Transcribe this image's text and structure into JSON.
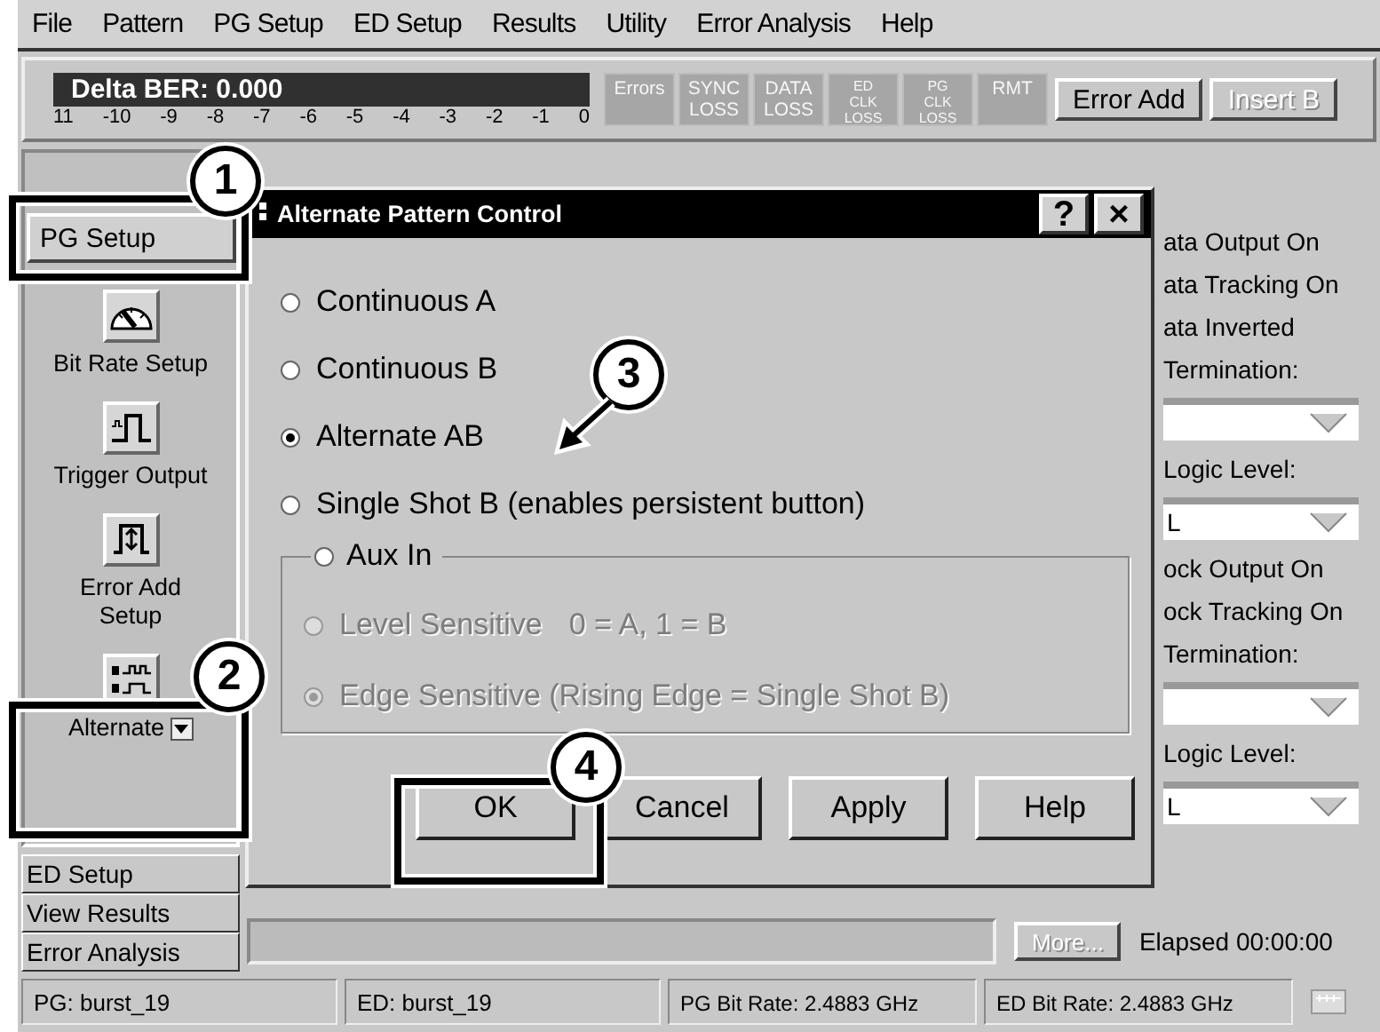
{
  "menu": [
    {
      "label": "File"
    },
    {
      "label": "Pattern"
    },
    {
      "label": "PG Setup"
    },
    {
      "label": "ED Setup"
    },
    {
      "label": "Results"
    },
    {
      "label": "Utility"
    },
    {
      "label": "Error Analysis"
    },
    {
      "label": "Help"
    }
  ],
  "toolbar": {
    "ber_display": {
      "text": "Delta BER: 0.000",
      "scale": [
        "11",
        "-10",
        "-9",
        "-8",
        "-7",
        "-6",
        "-5",
        "-4",
        "-3",
        "-2",
        "-1",
        "0"
      ]
    },
    "lamps": [
      {
        "label": "Errors",
        "kind": "normal"
      },
      {
        "label": "SYNC LOSS",
        "kind": "normal"
      },
      {
        "label": "DATA LOSS",
        "kind": "normal"
      },
      {
        "label": "ED CLK LOSS",
        "kind": "small"
      },
      {
        "label": "PG CLK LOSS",
        "kind": "small"
      },
      {
        "label": "RMT",
        "kind": "normal"
      }
    ],
    "buttons": [
      {
        "label": "Error Add",
        "disabled": false
      },
      {
        "label": "Insert B",
        "disabled": true
      }
    ]
  },
  "sidebar": {
    "top_button": {
      "label": "PG Setup"
    },
    "tools": [
      {
        "label": "Bit Rate Setup",
        "kind": "gauge",
        "dropdown": false
      },
      {
        "label": "Trigger Output",
        "kind": "pulse",
        "dropdown": false
      },
      {
        "label": "Error Add Setup",
        "kind": "error_add",
        "dropdown": false
      },
      {
        "label": "Alternate",
        "kind": "alternate",
        "dropdown": true
      }
    ],
    "bottom_buttons": [
      {
        "label": "ED Setup"
      },
      {
        "label": "View Results"
      },
      {
        "label": "Error Analysis"
      }
    ]
  },
  "right_panel": [
    {
      "kind": "text",
      "label": "ata Output On"
    },
    {
      "kind": "text",
      "label": "ata Tracking On"
    },
    {
      "kind": "text",
      "label": "ata Inverted"
    },
    {
      "kind": "text",
      "label": "Termination:"
    },
    {
      "kind": "dropdown"
    },
    {
      "kind": "text",
      "label": "Logic Level:"
    },
    {
      "kind": "dropdown",
      "value": "L"
    },
    {
      "kind": "text",
      "label": "ock Output On"
    },
    {
      "kind": "text",
      "label": "ock Tracking On"
    },
    {
      "kind": "text",
      "label": "Termination:"
    },
    {
      "kind": "dropdown"
    },
    {
      "kind": "text",
      "label": "Logic Level:"
    },
    {
      "kind": "dropdown",
      "value": "L"
    }
  ],
  "dialog": {
    "title": "Alternate Pattern Control",
    "help_button": "?",
    "close_button": "×",
    "options": [
      {
        "label": "Continuous A",
        "selected": false
      },
      {
        "label": "Continuous B",
        "selected": false
      },
      {
        "label": "Alternate AB",
        "selected": true
      },
      {
        "label": "Single Shot B (enables persistent button)",
        "selected": false
      }
    ],
    "aux_group": {
      "label": "Aux In",
      "selected": false,
      "options": [
        {
          "label": "Level Sensitive",
          "note": "0 = A, 1 = B",
          "selected": false,
          "disabled": true
        },
        {
          "label": "Edge Sensitive (Rising Edge = Single Shot B)",
          "selected": true,
          "disabled": true
        }
      ]
    },
    "buttons": [
      {
        "label": "OK"
      },
      {
        "label": "Cancel"
      },
      {
        "label": "Apply"
      },
      {
        "label": "Help"
      }
    ]
  },
  "bottom_bar": {
    "more_button": {
      "label": "More...",
      "disabled": true
    },
    "elapsed": "Elapsed 00:00:00"
  },
  "status_bar": [
    "PG: burst_19",
    "ED: burst_19",
    "PG Bit Rate: 2.4883 GHz",
    "ED Bit Rate: 2.4883 GHz"
  ],
  "callouts": [
    "1",
    "2",
    "3",
    "4"
  ]
}
